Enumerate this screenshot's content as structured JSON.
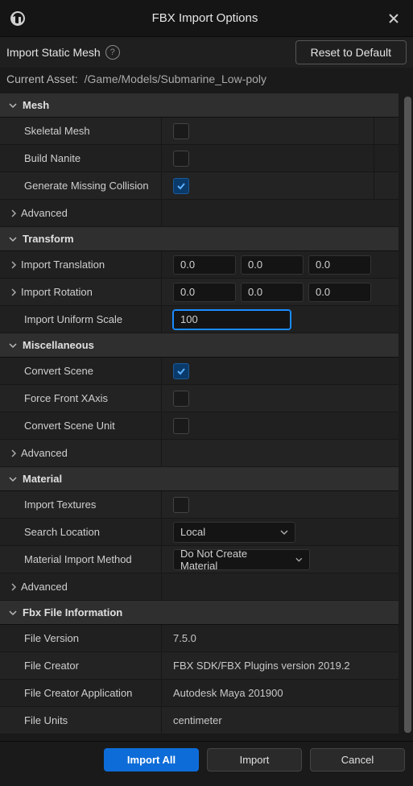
{
  "window": {
    "title": "FBX Import Options",
    "subtitle": "Import Static Mesh",
    "reset_button": "Reset to Default",
    "asset_label": "Current Asset:",
    "asset_path": "/Game/Models/Submarine_Low-poly"
  },
  "sections": {
    "mesh": {
      "title": "Mesh",
      "skeletal_mesh": {
        "label": "Skeletal Mesh",
        "checked": false
      },
      "build_nanite": {
        "label": "Build Nanite",
        "checked": false
      },
      "generate_collision": {
        "label": "Generate Missing Collision",
        "checked": true
      },
      "advanced": "Advanced"
    },
    "transform": {
      "title": "Transform",
      "translation": {
        "label": "Import Translation",
        "x": "0.0",
        "y": "0.0",
        "z": "0.0"
      },
      "rotation": {
        "label": "Import Rotation",
        "x": "0.0",
        "y": "0.0",
        "z": "0.0"
      },
      "uniform_scale": {
        "label": "Import Uniform Scale",
        "value": "100"
      }
    },
    "misc": {
      "title": "Miscellaneous",
      "convert_scene": {
        "label": "Convert Scene",
        "checked": true
      },
      "force_front_x": {
        "label": "Force Front XAxis",
        "checked": false
      },
      "convert_scene_unit": {
        "label": "Convert Scene Unit",
        "checked": false
      },
      "advanced": "Advanced"
    },
    "material": {
      "title": "Material",
      "import_textures": {
        "label": "Import Textures",
        "checked": false
      },
      "search_location": {
        "label": "Search Location",
        "value": "Local"
      },
      "import_method": {
        "label": "Material Import Method",
        "value": "Do Not Create Material"
      },
      "advanced": "Advanced"
    },
    "fileinfo": {
      "title": "Fbx File Information",
      "version": {
        "label": "File Version",
        "value": "7.5.0"
      },
      "creator": {
        "label": "File Creator",
        "value": "FBX SDK/FBX Plugins version 2019.2"
      },
      "creator_app": {
        "label": "File Creator Application",
        "value": "Autodesk Maya 201900"
      },
      "units": {
        "label": "File Units",
        "value": "centimeter"
      }
    }
  },
  "footer": {
    "import_all": "Import All",
    "import": "Import",
    "cancel": "Cancel"
  }
}
